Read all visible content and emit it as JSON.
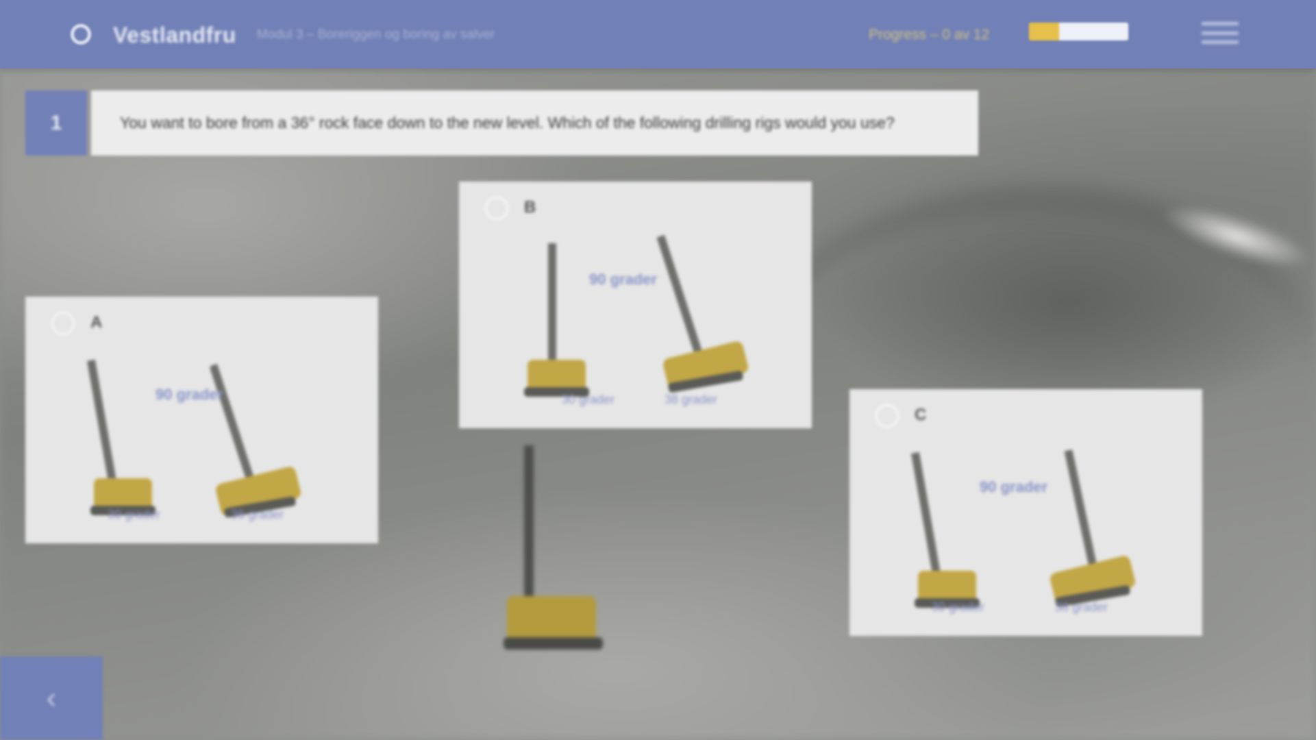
{
  "header": {
    "brand": "Vestlandfru",
    "course": "Modul 3 – Boreriggen og boring av salver",
    "progress_label": "Progress – 0 av 12",
    "progress_fraction": 0.3,
    "colors": {
      "bar": "#7180b6",
      "accent": "#e6c04a"
    }
  },
  "question": {
    "number": "1",
    "text": "You want to bore from a 36° rock face down to the new level. Which of the following drilling rigs would you use?"
  },
  "options": [
    {
      "letter": "A",
      "mid_label": "90 grader",
      "label_a": "30 grader",
      "label_b": "36 grader"
    },
    {
      "letter": "B",
      "mid_label": "90 grader",
      "label_a": "30 grader",
      "label_b": "38 grader"
    },
    {
      "letter": "C",
      "mid_label": "90 grader",
      "label_a": "30 grader",
      "label_b": "38 grader"
    }
  ],
  "icons": {
    "logo": "logo-mark-icon",
    "menu": "hamburger-menu-icon",
    "back": "chevron-left-icon",
    "radio": "radio-unselected-icon"
  },
  "nav": {
    "back_symbol": "‹"
  }
}
